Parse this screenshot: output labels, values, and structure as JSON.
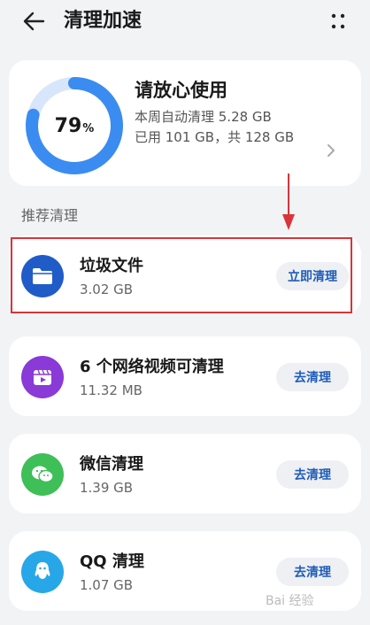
{
  "header": {
    "title": "清理加速",
    "back_icon": "arrow-left-icon",
    "more_icon": "more-dots-icon"
  },
  "summary": {
    "percent_value": "79",
    "percent_sign": "%",
    "usage_fraction": 0.79,
    "title": "请放心使用",
    "week_cleaned": "本周自动清理 5.28 GB",
    "used_total": "已用 101 GB，共 128 GB"
  },
  "section": {
    "title": "推荐清理"
  },
  "items": [
    {
      "title": "垃圾文件",
      "size": "3.02 GB",
      "action": "立即清理",
      "icon": "folder-icon",
      "icon_color": "#1f5cc8"
    },
    {
      "title": "6 个网络视频可清理",
      "size": "11.32 MB",
      "action": "去清理",
      "icon": "video-icon",
      "icon_color": "#8a3ad6"
    },
    {
      "title": "微信清理",
      "size": "1.39 GB",
      "action": "去清理",
      "icon": "wechat-icon",
      "icon_color": "#3fbf57"
    },
    {
      "title": "QQ 清理",
      "size": "1.07 GB",
      "action": "去清理",
      "icon": "qq-icon",
      "icon_color": "#28a7e8"
    }
  ],
  "watermark": "Bai 经验",
  "colors": {
    "accent": "#1f5cb8",
    "gauge": "#3b8cf0",
    "highlight": "#d9343a"
  }
}
